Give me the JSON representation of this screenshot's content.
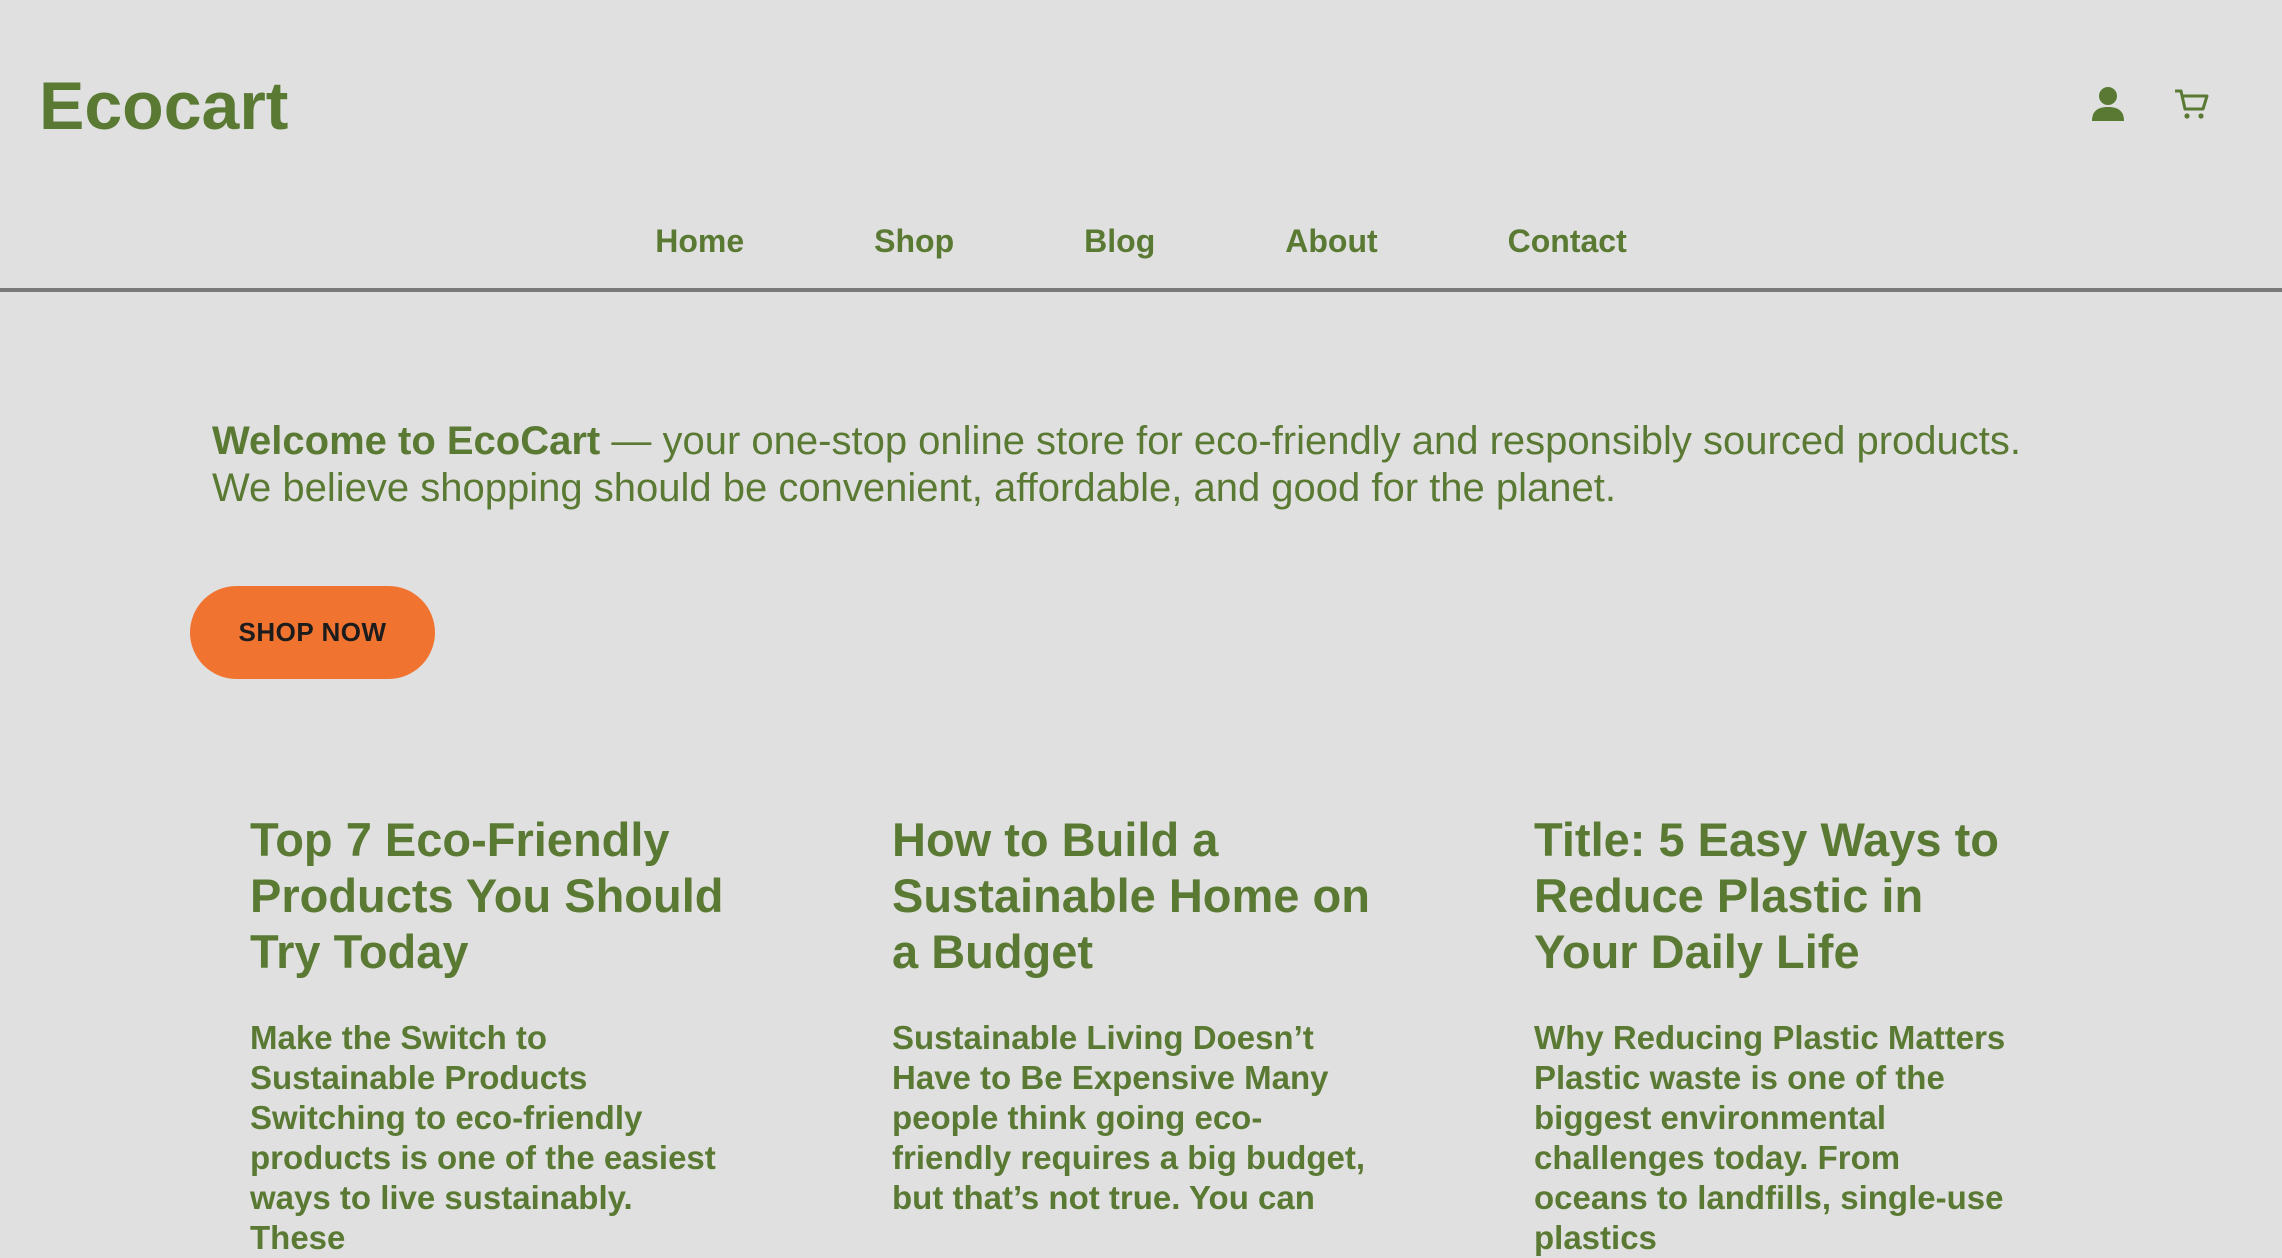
{
  "header": {
    "logo": "Ecocart",
    "icons": [
      "user-icon",
      "cart-icon"
    ]
  },
  "nav": {
    "items": [
      {
        "label": "Home"
      },
      {
        "label": "Shop"
      },
      {
        "label": "Blog"
      },
      {
        "label": "About"
      },
      {
        "label": "Contact"
      }
    ]
  },
  "hero": {
    "bold_text": "Welcome to EcoCart",
    "text": " — your one-stop online store for eco-friendly and responsibly sourced products. We believe shopping should be convenient, affordable, and good for the planet.",
    "button_label": "SHOP NOW"
  },
  "posts": [
    {
      "title": "Top 7 Eco-Friendly Products You Should Try Today",
      "excerpt": "Make the Switch to Sustainable Products Switching to eco-friendly products is one of the easiest ways to live sustainably. These"
    },
    {
      "title": "How to Build a Sustainable Home on a Budget",
      "excerpt": "Sustainable Living Doesn’t Have to Be Expensive Many people think going eco-friendly requires a big budget, but that’s not true. You can"
    },
    {
      "title": "Title: 5 Easy Ways to Reduce Plastic in Your Daily Life",
      "excerpt": "Why Reducing Plastic Matters Plastic waste is one of the biggest environmental challenges today. From oceans to landfills, single-use plastics"
    }
  ],
  "colors": {
    "background": "#e0e0e0",
    "brand_green": "#5a7a34",
    "accent_orange": "#f07430",
    "divider": "#7a7a7a"
  }
}
